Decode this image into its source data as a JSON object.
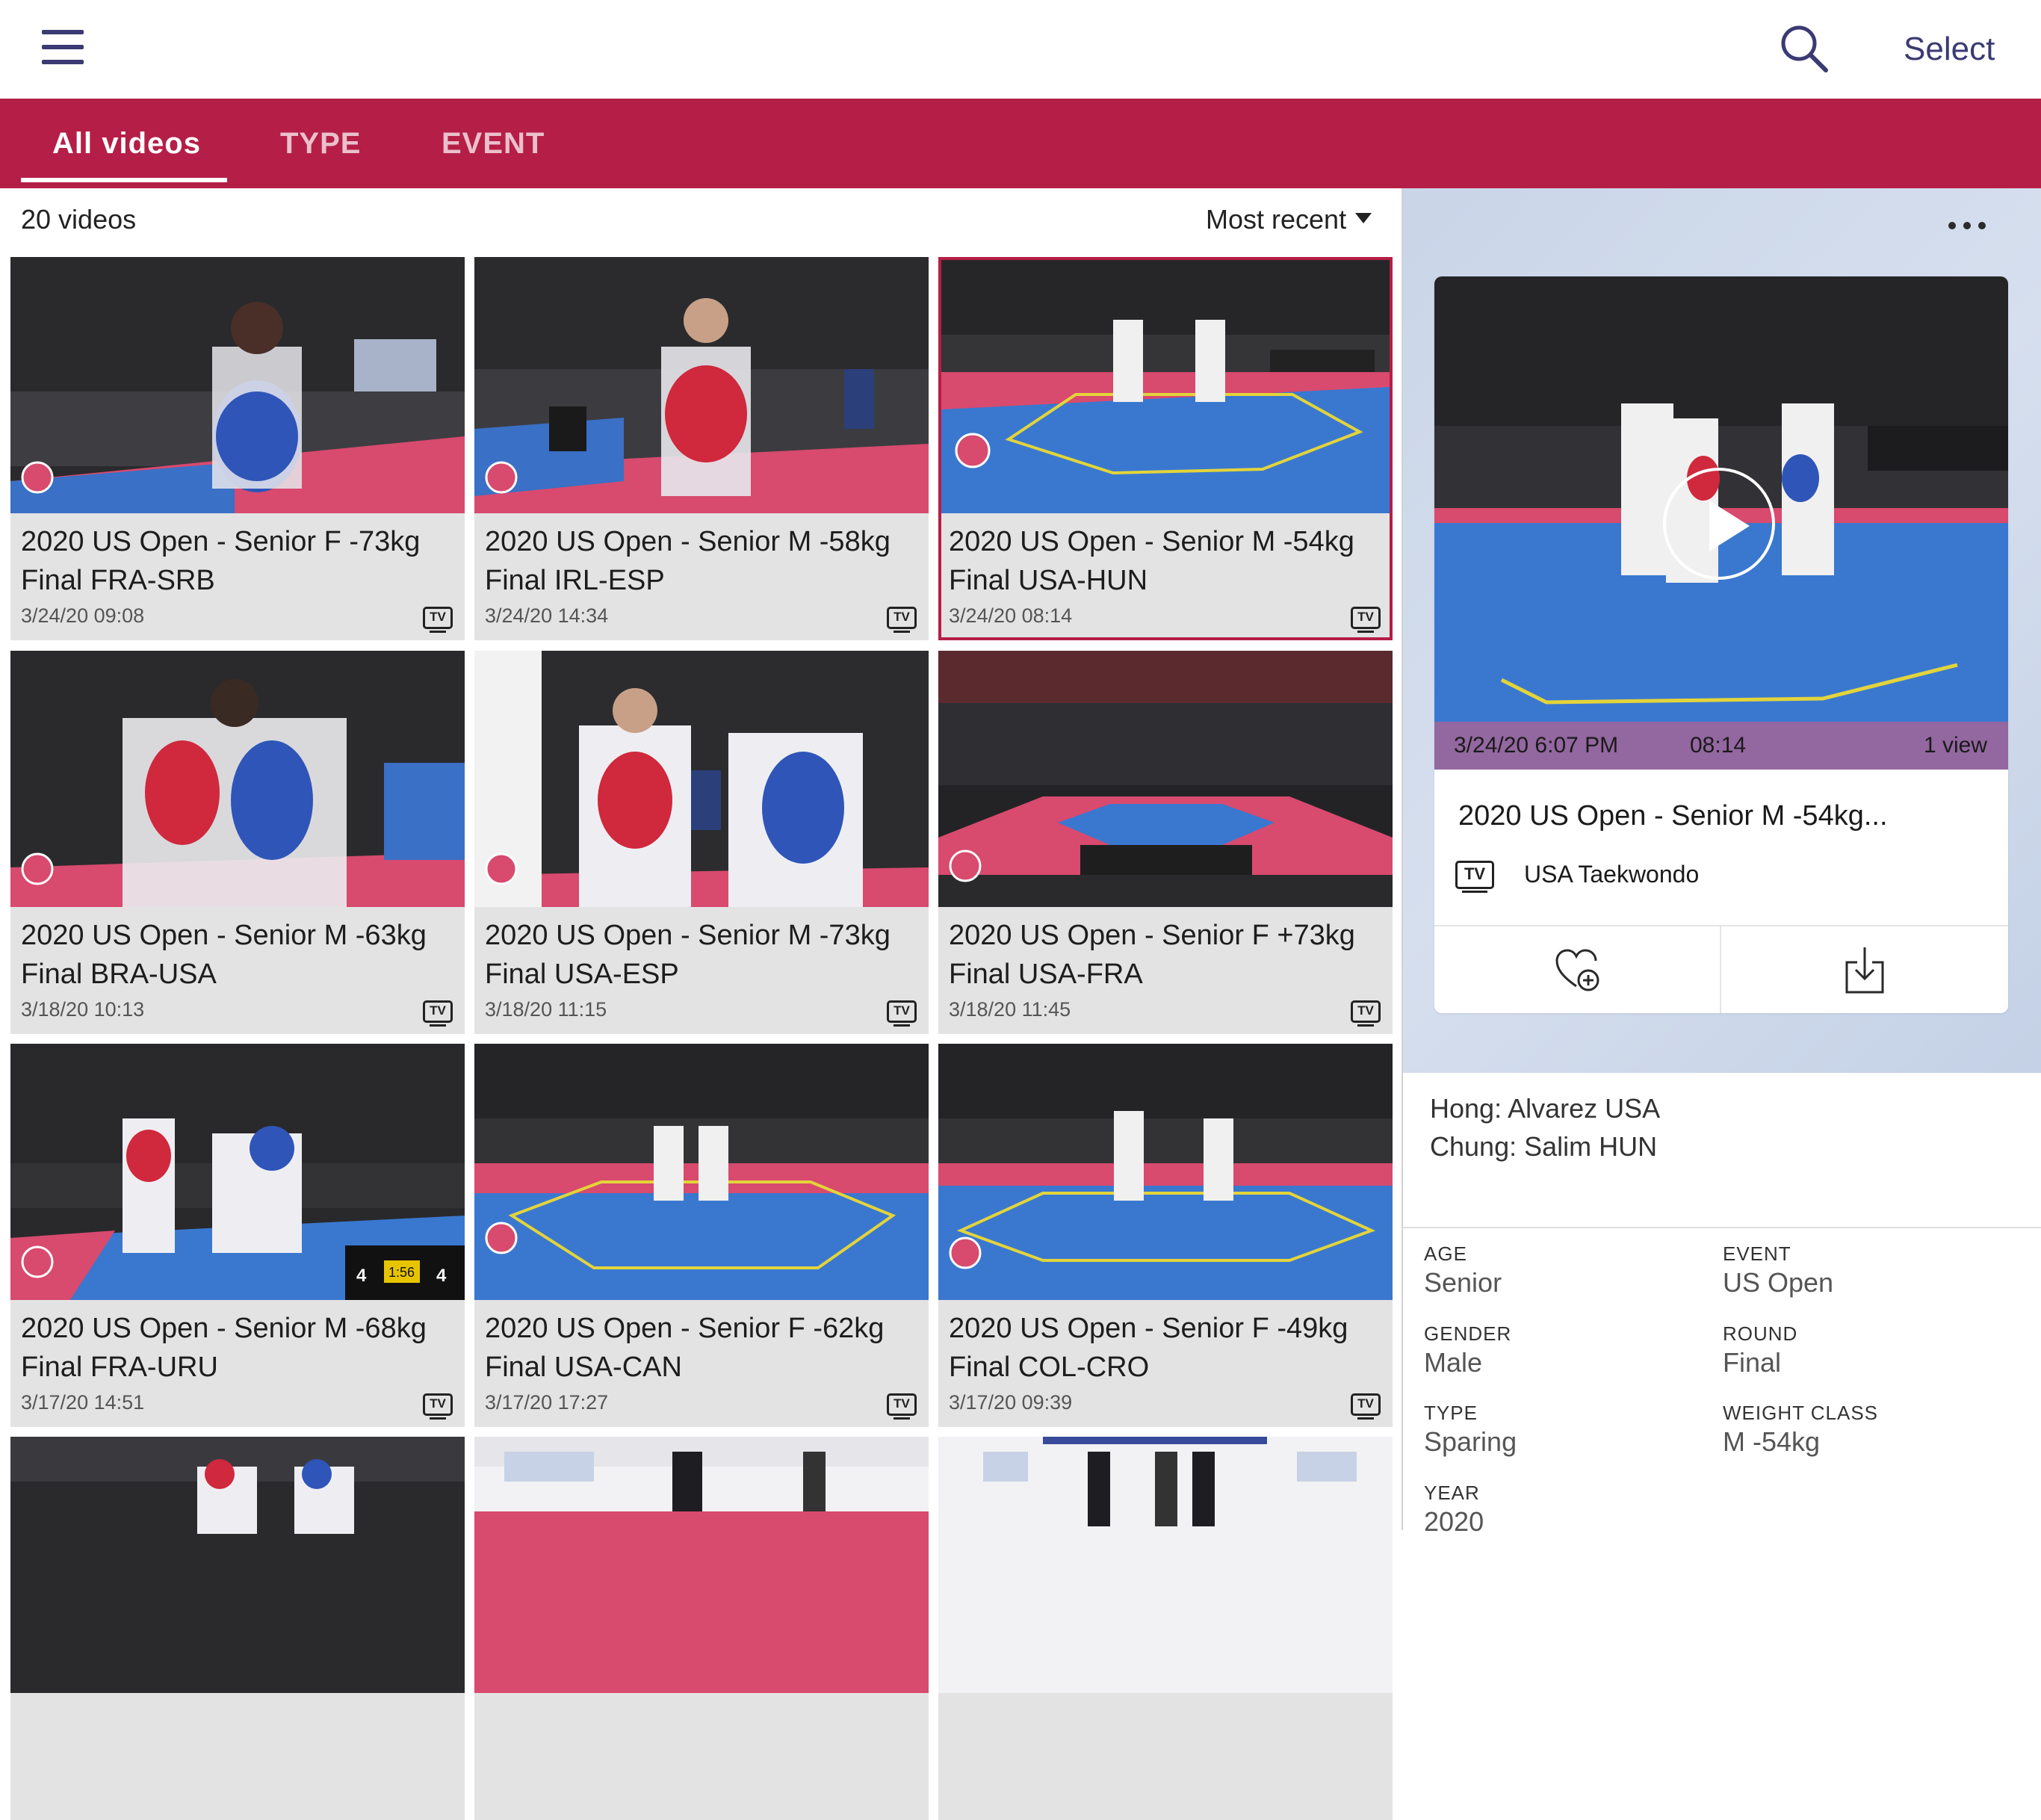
{
  "nav": {
    "select_label": "Select"
  },
  "tabs": [
    "All videos",
    "TYPE",
    "EVENT"
  ],
  "list": {
    "count_label": "20 videos",
    "sort_label": "Most recent"
  },
  "videos": [
    {
      "title": "2020 US Open - Senior F -73kg Final FRA-SRB",
      "date": "3/24/20 09:08",
      "badge": "TV"
    },
    {
      "title": "2020 US Open - Senior M -58kg Final IRL-ESP",
      "date": "3/24/20 14:34",
      "badge": "TV"
    },
    {
      "title": "2020 US Open - Senior M -54kg Final USA-HUN",
      "date": "3/24/20 08:14",
      "badge": "TV"
    },
    {
      "title": "2020 US Open - Senior M -63kg Final BRA-USA",
      "date": "3/18/20 10:13",
      "badge": "TV"
    },
    {
      "title": "2020 US Open - Senior M -73kg Final USA-ESP",
      "date": "3/18/20 11:15",
      "badge": "TV"
    },
    {
      "title": "2020 US Open - Senior F +73kg Final USA-FRA",
      "date": "3/18/20 11:45",
      "badge": "TV"
    },
    {
      "title": "2020 US Open - Senior M -68kg Final FRA-URU",
      "date": "3/17/20 14:51",
      "badge": "TV"
    },
    {
      "title": "2020 US Open - Senior F -62kg Final USA-CAN",
      "date": "3/17/20 17:27",
      "badge": "TV"
    },
    {
      "title": "2020 US Open - Senior F -49kg Final COL-CRO",
      "date": "3/17/20 09:39",
      "badge": "TV"
    }
  ],
  "thumb_score": {
    "left": "4",
    "clock": "1:56",
    "right": "4"
  },
  "detail": {
    "date": "3/24/20 6:07 PM",
    "time": "08:14",
    "views": "1 view",
    "title": "2020 US Open - Senior M -54kg...",
    "channel": "USA Taekwondo",
    "badge": "TV",
    "description": [
      "Hong: Alvarez USA",
      "Chung: Salim HUN"
    ],
    "fields": [
      {
        "label": "AGE",
        "value": "Senior"
      },
      {
        "label": "EVENT",
        "value": "US Open"
      },
      {
        "label": "GENDER",
        "value": "Male"
      },
      {
        "label": "ROUND",
        "value": "Final"
      },
      {
        "label": "TYPE",
        "value": "Sparing"
      },
      {
        "label": "WEIGHT CLASS",
        "value": "M -54kg"
      },
      {
        "label": "YEAR",
        "value": "2020"
      }
    ]
  },
  "colors": {
    "brand": "#b51e46",
    "nav_icon": "#3b3a73",
    "mat_blue": "#3a78d0",
    "mat_red": "#e0486e"
  },
  "icons": [
    "menu-icon",
    "search-icon",
    "more-icon",
    "tv-icon",
    "play-icon",
    "favorite-add-icon",
    "download-icon"
  ]
}
